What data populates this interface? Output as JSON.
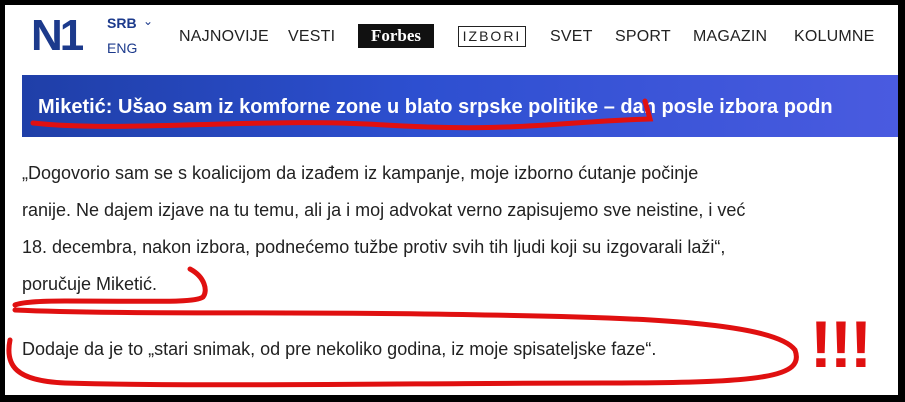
{
  "header": {
    "logo": "N1",
    "lang_primary": "SRB",
    "lang_secondary": "ENG",
    "nav_items": [
      "NAJNOVIJE",
      "VESTI",
      "Forbes",
      "IZBORI",
      "SVET",
      "SPORT",
      "MAGAZIN",
      "KOLUMNE"
    ]
  },
  "headline": "Miketić: Ušao sam iz komforne zone u blato srpske politike – dan posle izbora podn",
  "article": {
    "paragraph1_lines": [
      "„Dogovorio sam se s koalicijom da izađem iz kampanje, moje izborno ćutanje počinje",
      "ranije. Ne dajem izjave na tu temu, ali ja i moj advokat verno zapisujemo sve neistine, i već",
      "18. decembra, nakon izbora, podnećemo tužbe protiv svih tih ljudi koji su izgovarali laži“,",
      "poručuje Miketić."
    ],
    "paragraph2": "Dodaje da je to „stari snimak, od pre nekoliko godina, iz moje spisateljske faze“."
  },
  "annotation": {
    "exclamation": "!!!",
    "color": "#e01010"
  },
  "colors": {
    "brand": "#1c3a8c",
    "banner": "#2d4fd0"
  }
}
